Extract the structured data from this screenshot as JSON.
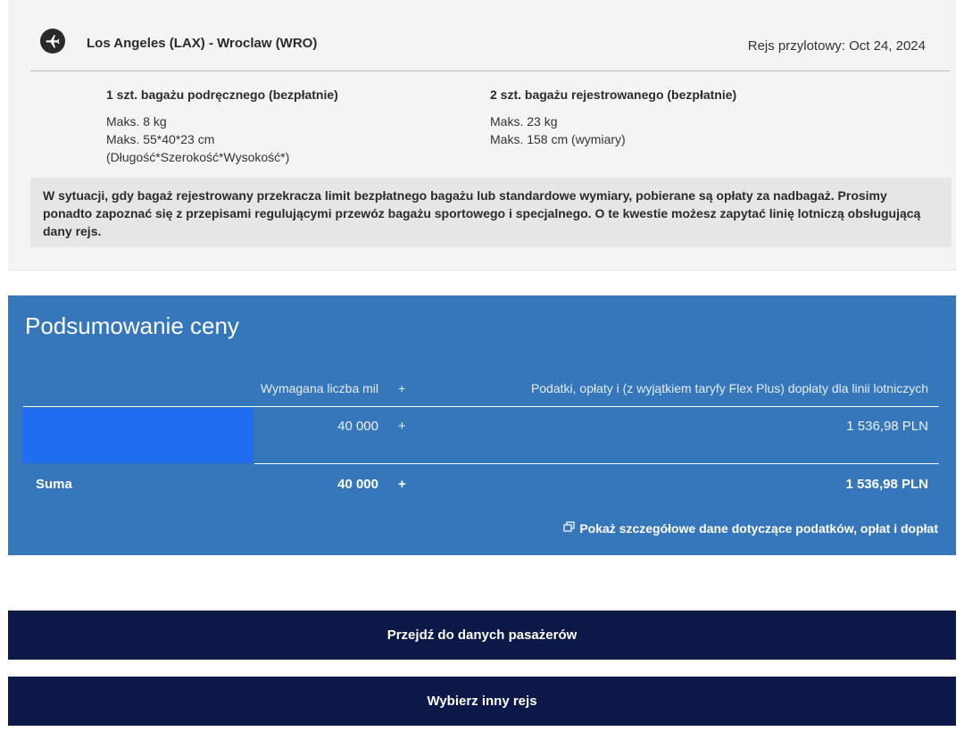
{
  "flight": {
    "route": "Los Angeles (LAX) - Wroclaw (WRO)",
    "return_date": "Rejs przylotowy: Oct 24, 2024",
    "carry_on": {
      "title": "1 szt. bagażu podręcznego (bezpłatnie)",
      "lines": [
        "Maks. 8 kg",
        "Maks. 55*40*23 cm",
        "(Długość*Szerokość*Wysokość*)"
      ]
    },
    "checked": {
      "title": "2 szt. bagażu rejestrowanego (bezpłatnie)",
      "lines": [
        "Maks. 23 kg",
        "Maks. 158 cm (wymiary)"
      ]
    },
    "notice": "W sytuacji, gdy bagaż rejestrowany przekracza limit bezpłatnego bagażu lub standardowe wymiary, pobierane są opłaty za nadbagaż. Prosimy ponadto zapoznać się z przepisami regulującymi przewóz bagażu sportowego i specjalnego. O te kwestie możesz zapytać linię lotniczą obsługującą dany rejs.",
    "icon": "airplane-icon"
  },
  "price_summary": {
    "title": "Podsumowanie ceny",
    "columns": {
      "miles": "Wymagana liczba mil",
      "plus": "+",
      "taxes": "Podatki, opłaty i (z wyjątkiem taryfy Flex Plus) dopłaty dla linii lotniczych"
    },
    "row": {
      "miles": "40 000",
      "plus": "+",
      "taxes": "1 536,98 PLN"
    },
    "total": {
      "label": "Suma",
      "miles": "40 000",
      "plus": "+",
      "taxes": "1 536,98 PLN"
    },
    "details_link": "Pokaż szczegółowe dane dotyczące podatków, opłat i dopłat",
    "details_icon": "external-window-icon",
    "panel_color": "#3677bb"
  },
  "buttons": {
    "continue": "Przejdź do danych pasażerów",
    "other_flight": "Wybierz inny rejs",
    "color": "#0b1848"
  }
}
